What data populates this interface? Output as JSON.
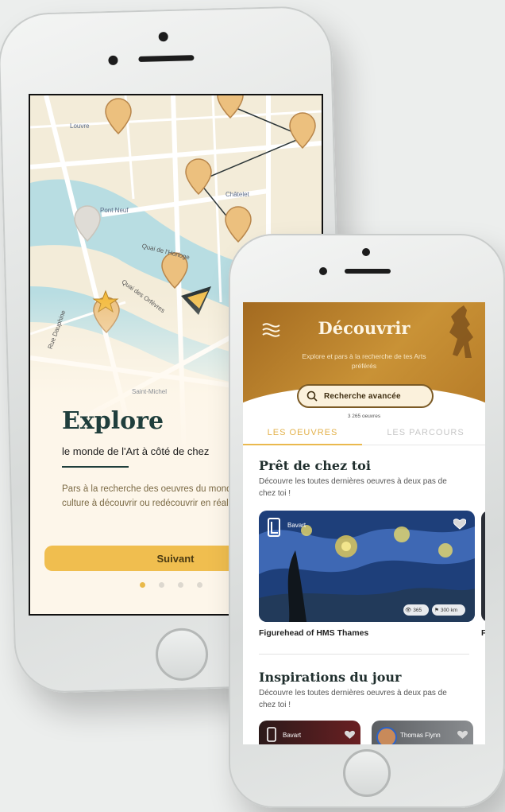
{
  "onboarding": {
    "title": "Explore",
    "subtitle": "le monde de l'Art à côté de chez",
    "body": "Pars à la recherche des oeuvres du monde de l'art et la culture à découvrir ou redécouvrir en réalité augmenté.",
    "next_button": "Suivant",
    "pager": {
      "count": 4,
      "active_index": 0
    },
    "map_labels": [
      "Louvre",
      "Pont Neuf",
      "Châtelet",
      "Quai de l'Horloge",
      "Quai des Orfèvres",
      "Rue Dauphine",
      "Saint-Michel"
    ]
  },
  "discover": {
    "title": "Découvrir",
    "tagline": "Explore et pars à la recherche de tes Arts préférés",
    "search_label": "Recherche avancée",
    "results_count": "3 265 oeuvres",
    "tabs": [
      {
        "label": "LES OEUVRES",
        "active": true
      },
      {
        "label": "LES PARCOURS",
        "active": false
      }
    ],
    "near_you": {
      "title": "Prêt de chez toi",
      "description": "Découvre les toutes dernières oeuvres à deux pas de chez toi !",
      "cards": [
        {
          "brand": "Bavart",
          "views": "365",
          "distance": "300 km",
          "name": "Figurehead of HMS Thames",
          "icons": [
            "logo-icon",
            "heart-icon",
            "eye-icon",
            "flag-icon"
          ]
        },
        {
          "name": "F"
        }
      ]
    },
    "inspirations": {
      "title": "Inspirations du jour",
      "description": "Découvre les toutes dernières oeuvres à deux pas de chez toi !",
      "cards": [
        {
          "brand": "Bavart"
        },
        {
          "brand": "Thomas Flynn"
        }
      ]
    },
    "colors": {
      "accent": "#eab94e",
      "header_gold": "#b57a27",
      "title_dark": "#1f3e3c"
    }
  }
}
